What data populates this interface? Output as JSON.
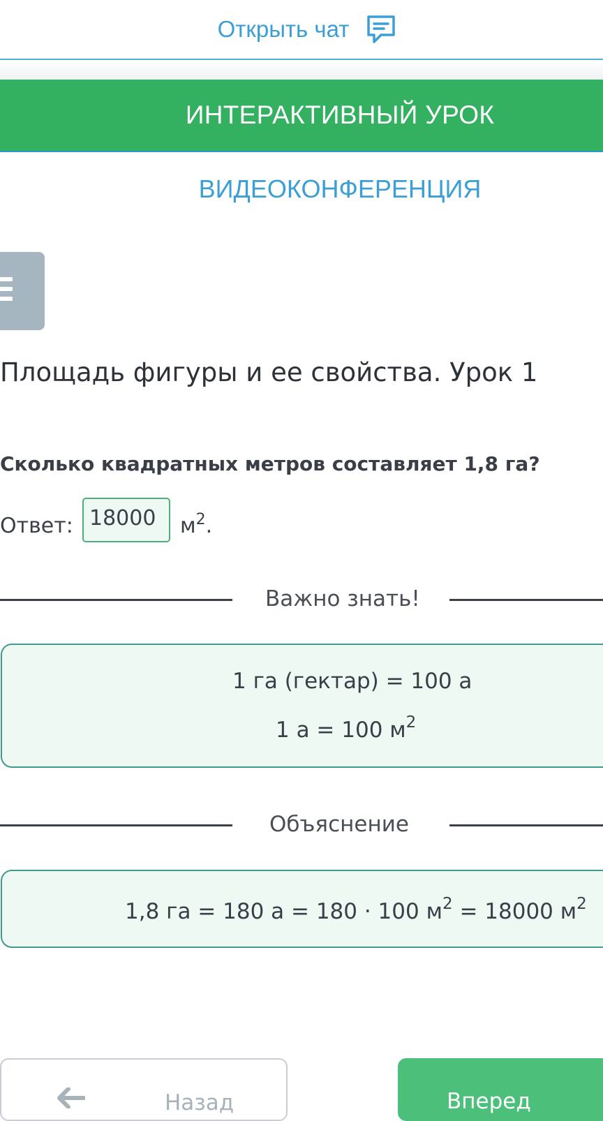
{
  "header": {
    "chat_link_label": "Открыть чат",
    "chat_icon": "chat-bubble-icon"
  },
  "tabs": {
    "interactive_lesson": "ИНТЕРАКТИВНЫЙ УРОК",
    "video_conference": "ВИДЕОКОНФЕРЕНЦИЯ"
  },
  "menu": {
    "icon": "hamburger-menu-icon"
  },
  "lesson": {
    "title": "Площадь фигуры и ее свойства. Урок 1"
  },
  "task": {
    "question": "Сколько квадратных метров составляет 1,8 га?",
    "answer_label": "Ответ:",
    "answer_value": "18000",
    "unit_base": "м",
    "unit_exp": "2",
    "unit_tail": "."
  },
  "important": {
    "title": "Важно знать!",
    "line1": "1 га (гектар) = 100 а",
    "line2_text": "1 а = 100 м",
    "line2_exp": "2"
  },
  "explanation": {
    "title": "Объяснение",
    "part1": "1,8 га = 180 а = 180 · 100 м",
    "exp1": "2",
    "part2": " = 18000 м",
    "exp2": "2"
  },
  "navigation": {
    "back_label": "Назад",
    "back_icon": "arrow-left-icon",
    "next_label": "Вперед"
  },
  "colors": {
    "accent_green": "#33b060",
    "link_blue": "#3b9fd6",
    "box_border": "#3f9a8c",
    "box_fill": "#eef9f4"
  }
}
